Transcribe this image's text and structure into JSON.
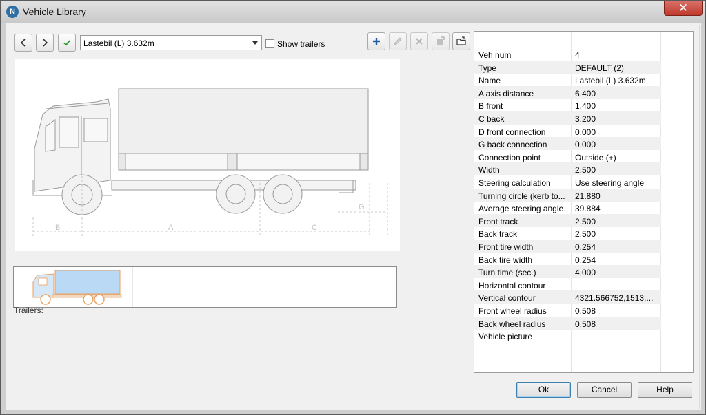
{
  "window": {
    "title": "Vehicle Library",
    "app_icon_letter": "N",
    "close_glyph": "✕"
  },
  "toolbar": {
    "prev_icon": "chevron-left-icon",
    "next_icon": "chevron-right-icon",
    "apply_icon": "checkmark-icon",
    "vehicle_select": {
      "value": "Lastebil (L) 3.632m"
    },
    "show_trailers": {
      "label": "Show trailers",
      "checked": false
    },
    "actions": [
      "add-icon",
      "edit-icon",
      "delete-icon",
      "export-icon",
      "open-folder-icon"
    ]
  },
  "preview": {
    "dimension_labels": {
      "b": "B",
      "a": "A",
      "c": "C",
      "g": "G"
    }
  },
  "trailers": {
    "label": "Trailers:"
  },
  "properties": [
    {
      "key": "Veh num",
      "value": "4"
    },
    {
      "key": "Type",
      "value": "DEFAULT (2)"
    },
    {
      "key": "Name",
      "value": "Lastebil (L) 3.632m"
    },
    {
      "key": "A axis distance",
      "value": "6.400"
    },
    {
      "key": "B front",
      "value": "1.400"
    },
    {
      "key": "C back",
      "value": "3.200"
    },
    {
      "key": "D front connection",
      "value": "0.000"
    },
    {
      "key": "G back connection",
      "value": "0.000"
    },
    {
      "key": "Connection point",
      "value": "Outside (+)"
    },
    {
      "key": "Width",
      "value": "2.500"
    },
    {
      "key": "Steering calculation",
      "value": "Use steering angle"
    },
    {
      "key": "Turning circle (kerb to...",
      "value": "21.880"
    },
    {
      "key": "Average steering angle",
      "value": "39.884"
    },
    {
      "key": "Front track",
      "value": "2.500"
    },
    {
      "key": "Back track",
      "value": "2.500"
    },
    {
      "key": "Front tire width",
      "value": "0.254"
    },
    {
      "key": "Back tire width",
      "value": "0.254"
    },
    {
      "key": "Turn time (sec.)",
      "value": "4.000"
    },
    {
      "key": "Horizontal contour",
      "value": ""
    },
    {
      "key": "Vertical contour",
      "value": "4321.566752,1513...."
    },
    {
      "key": "Front wheel radius",
      "value": "0.508"
    },
    {
      "key": "Back wheel radius",
      "value": "0.508"
    },
    {
      "key": "Vehicle picture",
      "value": ""
    }
  ],
  "buttons": {
    "ok": "Ok",
    "cancel": "Cancel",
    "help": "Help"
  },
  "colors": {
    "accent": "#3c7fb1",
    "apply_green": "#2e9a2e",
    "add_blue": "#1f5fa0",
    "thumb_orange": "#e8a060",
    "thumb_fill": "#b9d9f5"
  }
}
